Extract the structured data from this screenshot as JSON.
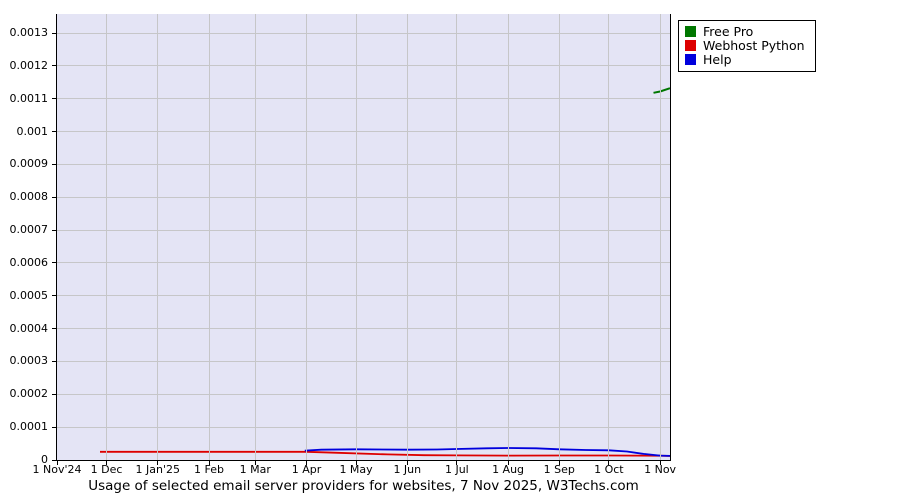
{
  "title": "Usage of selected email server providers for websites, 7 Nov 2025, W3Techs.com",
  "legend": {
    "items": [
      {
        "label": "Free Pro",
        "color": "#007700"
      },
      {
        "label": "Webhost Python",
        "color": "#dd0000"
      },
      {
        "label": "Help",
        "color": "#0000dd"
      }
    ]
  },
  "chart_data": {
    "type": "line",
    "title": "Usage of selected email server providers for websites, 7 Nov 2025, W3Techs.com",
    "xlabel": "",
    "ylabel": "",
    "x_unit": "days since 1 Nov 2024",
    "x_domain": [
      0,
      371
    ],
    "ylim": [
      0,
      0.001358
    ],
    "y_tick_step": 0.0001,
    "y_tick_labels": [
      "0",
      "0.0001",
      "0.0002",
      "0.0003",
      "0.0004",
      "0.0005",
      "0.0006",
      "0.0007",
      "0.0008",
      "0.0009",
      "0.001",
      "0.0011",
      "0.0012",
      "0.0013"
    ],
    "x_tick_days": [
      0,
      30,
      61,
      92,
      120,
      151,
      181,
      212,
      242,
      273,
      304,
      334,
      365
    ],
    "x_tick_labels": [
      "1 Nov'24",
      "1 Dec",
      "1 Jan'25",
      "1 Feb",
      "1 Mar",
      "1 Apr",
      "1 May",
      "1 Jun",
      "1 Jul",
      "1 Aug",
      "1 Sep",
      "1 Oct",
      "1 Nov"
    ],
    "grid": true,
    "plot_bg": "#e4e4f5",
    "grid_color": "#c6c6c8",
    "legend_position": "outside-top-right",
    "series": [
      {
        "name": "Webhost Python",
        "color": "#dd0000",
        "width": 1.8,
        "points": [
          [
            26,
            2.5e-05
          ],
          [
            120,
            2.5e-05
          ],
          [
            151,
            2.5e-05
          ],
          [
            170,
            2.2e-05
          ],
          [
            200,
            1.7e-05
          ],
          [
            222,
            1.45e-05
          ],
          [
            242,
            1.4e-05
          ],
          [
            273,
            1.35e-05
          ],
          [
            304,
            1.38e-05
          ],
          [
            334,
            1.38e-05
          ],
          [
            365,
            1.3e-05
          ],
          [
            371,
            1.22e-05
          ]
        ]
      },
      {
        "name": "Help",
        "color": "#0000dd",
        "width": 1.8,
        "points": [
          [
            150,
            2.85e-05
          ],
          [
            160,
            3.15e-05
          ],
          [
            181,
            3.25e-05
          ],
          [
            212,
            3.15e-05
          ],
          [
            230,
            3.2e-05
          ],
          [
            242,
            3.35e-05
          ],
          [
            260,
            3.55e-05
          ],
          [
            273,
            3.65e-05
          ],
          [
            290,
            3.55e-05
          ],
          [
            304,
            3.25e-05
          ],
          [
            320,
            3.05e-05
          ],
          [
            334,
            2.95e-05
          ],
          [
            345,
            2.6e-05
          ],
          [
            355,
            1.85e-05
          ],
          [
            365,
            1.35e-05
          ],
          [
            371,
            1.25e-05
          ]
        ]
      },
      {
        "name": "Free Pro",
        "color": "#007700",
        "width": 2,
        "points": [
          [
            361,
            0.001118
          ],
          [
            365,
            0.001122
          ],
          [
            371,
            0.001132
          ]
        ]
      }
    ]
  }
}
